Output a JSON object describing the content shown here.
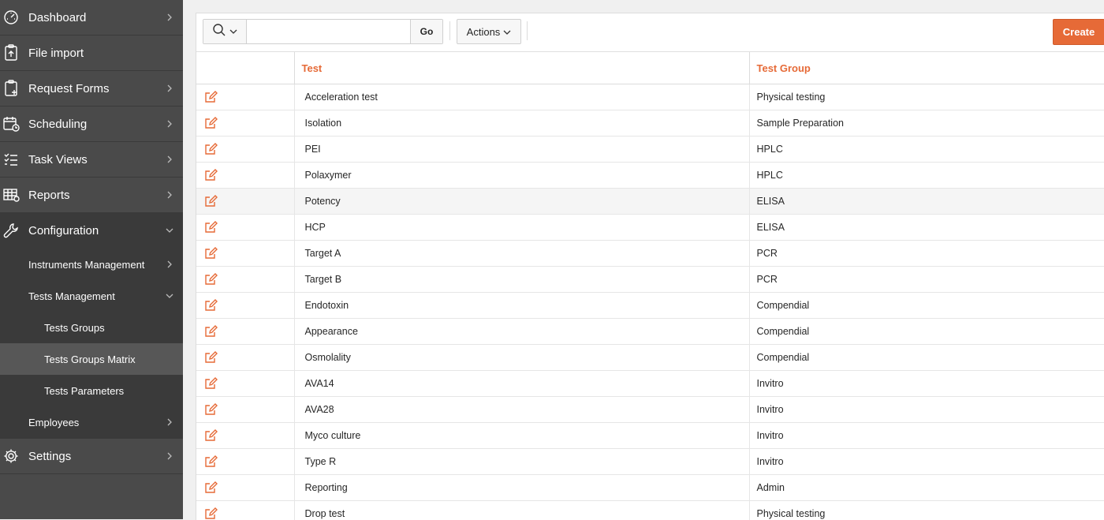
{
  "sidebar": {
    "items": [
      {
        "label": "Dashboard",
        "icon": "dashboard-icon",
        "has_children": true
      },
      {
        "label": "File import",
        "icon": "file-import-icon",
        "has_children": false
      },
      {
        "label": "Request Forms",
        "icon": "request-forms-icon",
        "has_children": true
      },
      {
        "label": "Scheduling",
        "icon": "calendar-clock-icon",
        "has_children": true
      },
      {
        "label": "Task Views",
        "icon": "checklist-icon",
        "has_children": true
      },
      {
        "label": "Reports",
        "icon": "table-report-icon",
        "has_children": true
      },
      {
        "label": "Configuration",
        "icon": "wrench-icon",
        "expanded": true
      }
    ],
    "config_children": [
      {
        "label": "Instruments Management",
        "has_children": true
      },
      {
        "label": "Tests Management",
        "expanded": true
      }
    ],
    "tests_children": [
      {
        "label": "Tests Groups"
      },
      {
        "label": "Tests Groups Matrix",
        "active": true
      },
      {
        "label": "Tests Parameters"
      }
    ],
    "employees": {
      "label": "Employees"
    },
    "settings": {
      "label": "Settings",
      "icon": "gear-icon"
    }
  },
  "toolbar": {
    "search_value": "",
    "go_label": "Go",
    "actions_label": "Actions",
    "create_label": "Create"
  },
  "table": {
    "headers": [
      "",
      "Test",
      "Test Group"
    ],
    "rows": [
      {
        "test": "Acceleration test",
        "group": "Physical testing"
      },
      {
        "test": "Isolation",
        "group": "Sample Preparation"
      },
      {
        "test": "PEI",
        "group": "HPLC"
      },
      {
        "test": "Polaxymer",
        "group": "HPLC"
      },
      {
        "test": "Potency",
        "group": "ELISA"
      },
      {
        "test": "HCP",
        "group": "ELISA"
      },
      {
        "test": "Target A",
        "group": "PCR"
      },
      {
        "test": "Target B",
        "group": "PCR"
      },
      {
        "test": "Endotoxin",
        "group": "Compendial"
      },
      {
        "test": "Appearance",
        "group": "Compendial"
      },
      {
        "test": "Osmolality",
        "group": "Compendial"
      },
      {
        "test": "AVA14",
        "group": "Invitro"
      },
      {
        "test": "AVA28",
        "group": "Invitro"
      },
      {
        "test": "Myco culture",
        "group": "Invitro"
      },
      {
        "test": "Type R",
        "group": "Invitro"
      },
      {
        "test": "Reporting",
        "group": "Admin"
      },
      {
        "test": "Drop test",
        "group": "Physical testing"
      }
    ]
  },
  "colors": {
    "accent": "#e66a37",
    "sidebar": "#4a4a4a",
    "sidebar_dark": "#3a3a3a"
  }
}
